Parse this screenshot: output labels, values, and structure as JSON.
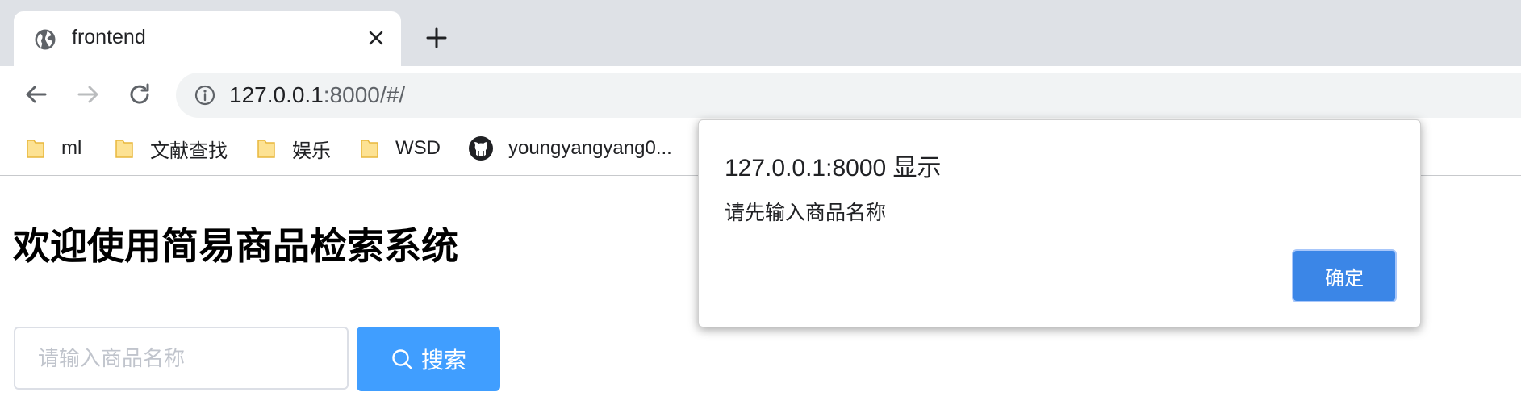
{
  "browser": {
    "tab": {
      "title": "frontend"
    },
    "url": {
      "host": "127.0.0.1",
      "rest": ":8000/#/"
    },
    "bookmarks": [
      {
        "label": "ml",
        "icon": "folder-icon"
      },
      {
        "label": "文献查找",
        "icon": "folder-icon"
      },
      {
        "label": "娱乐",
        "icon": "folder-icon"
      },
      {
        "label": "WSD",
        "icon": "folder-icon"
      },
      {
        "label": "youngyangyang0...",
        "icon": "github-icon"
      }
    ]
  },
  "page": {
    "title": "欢迎使用简易商品检索系统",
    "search": {
      "placeholder": "请输入商品名称",
      "value": "",
      "button_label": "搜索"
    }
  },
  "dialog": {
    "title": "127.0.0.1:8000 显示",
    "message": "请先输入商品名称",
    "ok_label": "确定"
  },
  "colors": {
    "accent": "#409eff",
    "dialog_button": "#3b86e7",
    "tabstrip": "#dee1e6",
    "omnibox": "#f1f3f4"
  }
}
